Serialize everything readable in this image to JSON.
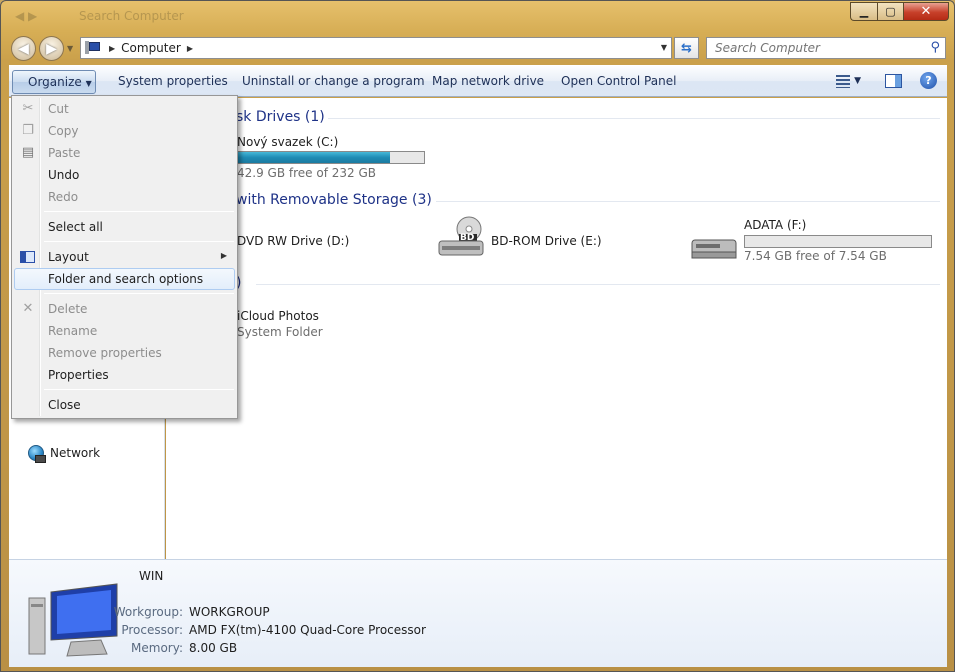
{
  "window": {
    "background_title": "Search Computer",
    "caption": {
      "minimize": "▁",
      "maximize": "▢",
      "close": "✕"
    }
  },
  "nav": {
    "back_icon": "back-arrow-icon",
    "forward_icon": "forward-arrow-icon",
    "address": {
      "location": "Computer"
    },
    "search": {
      "placeholder": "Search Computer"
    }
  },
  "toolbar": {
    "organize": "Organize",
    "system_properties": "System properties",
    "uninstall": "Uninstall or change a program",
    "map_drive": "Map network drive",
    "control_panel": "Open Control Panel"
  },
  "content": {
    "groups": [
      {
        "header": "sk Drives (1)"
      },
      {
        "header": " with Removable Storage (3)"
      },
      {
        "header": ")"
      }
    ],
    "hard_drives": [
      {
        "name": "Nový svazek (C:)",
        "free_text": "42.9 GB free of 232 GB",
        "used_fraction": 0.815
      }
    ],
    "removable": [
      {
        "name": "DVD RW Drive (D:)"
      },
      {
        "name": "BD-ROM Drive (E:)",
        "badge": "BD"
      },
      {
        "name": "ADATA (F:)",
        "free_text": "7.54 GB free of 7.54 GB",
        "used_fraction": 0.0
      }
    ],
    "other": [
      {
        "name": "iCloud Photos",
        "type": "System Folder"
      }
    ]
  },
  "nav_pane": {
    "network": "Network"
  },
  "details": {
    "name": "WIN",
    "rows": [
      {
        "label": "Workgroup:",
        "value": "WORKGROUP"
      },
      {
        "label": "Processor:",
        "value": "AMD FX(tm)-4100 Quad-Core Processor"
      },
      {
        "label": "Memory:",
        "value": "8.00 GB"
      }
    ]
  },
  "menu": {
    "items": [
      {
        "label": "Cut",
        "enabled": false
      },
      {
        "label": "Copy",
        "enabled": false
      },
      {
        "label": "Paste",
        "enabled": false
      },
      {
        "label": "Undo",
        "enabled": true
      },
      {
        "label": "Redo",
        "enabled": false
      },
      {
        "label": "Select all",
        "enabled": true
      },
      {
        "label": "Layout",
        "enabled": true
      },
      {
        "label": "Folder and search options",
        "enabled": true
      },
      {
        "label": "Delete",
        "enabled": false
      },
      {
        "label": "Rename",
        "enabled": false
      },
      {
        "label": "Remove properties",
        "enabled": false
      },
      {
        "label": "Properties",
        "enabled": true
      },
      {
        "label": "Close",
        "enabled": true
      }
    ]
  },
  "colors": {
    "accent": "#1e3287",
    "capacity_fill": "#1f8bb4",
    "title_glass": "#d7ae55"
  }
}
